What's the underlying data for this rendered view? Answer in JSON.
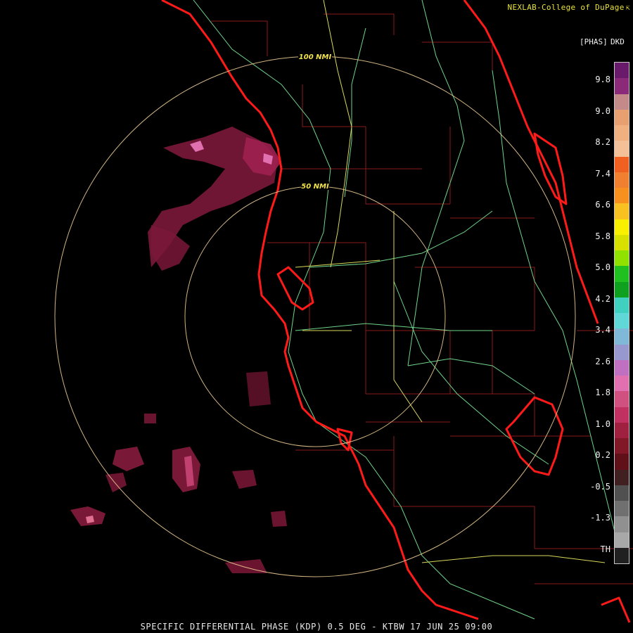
{
  "credit": "NEXLAB-College of DuPage",
  "credit_icon": "arrow-icon",
  "legend": {
    "unit": "[PHAS]",
    "code": "DKD",
    "labels": [
      "9.8",
      "9.0",
      "8.2",
      "7.4",
      "6.6",
      "5.8",
      "5.0",
      "4.2",
      "3.4",
      "2.6",
      "1.8",
      "1.0",
      "0.2",
      "-0.5",
      "-1.3",
      "TH"
    ],
    "colors": [
      "#6a1a6a",
      "#8a2a78",
      "#c48a8a",
      "#e8a070",
      "#f0b080",
      "#f4c098",
      "#f06020",
      "#f08030",
      "#f89020",
      "#f8c020",
      "#f8f000",
      "#d8e000",
      "#90e000",
      "#20c020",
      "#10a020",
      "#40d0c0",
      "#60d8d8",
      "#80b8d8",
      "#9898d0",
      "#c070c0",
      "#e070b0",
      "#d05080",
      "#c03060",
      "#a02040",
      "#801828",
      "#601018",
      "#402020",
      "#505050",
      "#707070",
      "#909090",
      "#a8a8a8",
      "#202020"
    ]
  },
  "range_rings": [
    {
      "label": "50 NMI"
    },
    {
      "label": "100 NMI"
    }
  ],
  "footer": "SPECIFIC DIFFERENTIAL PHASE (KDP) 0.5 DEG - KTBW 17 JUN 25 09:00"
}
